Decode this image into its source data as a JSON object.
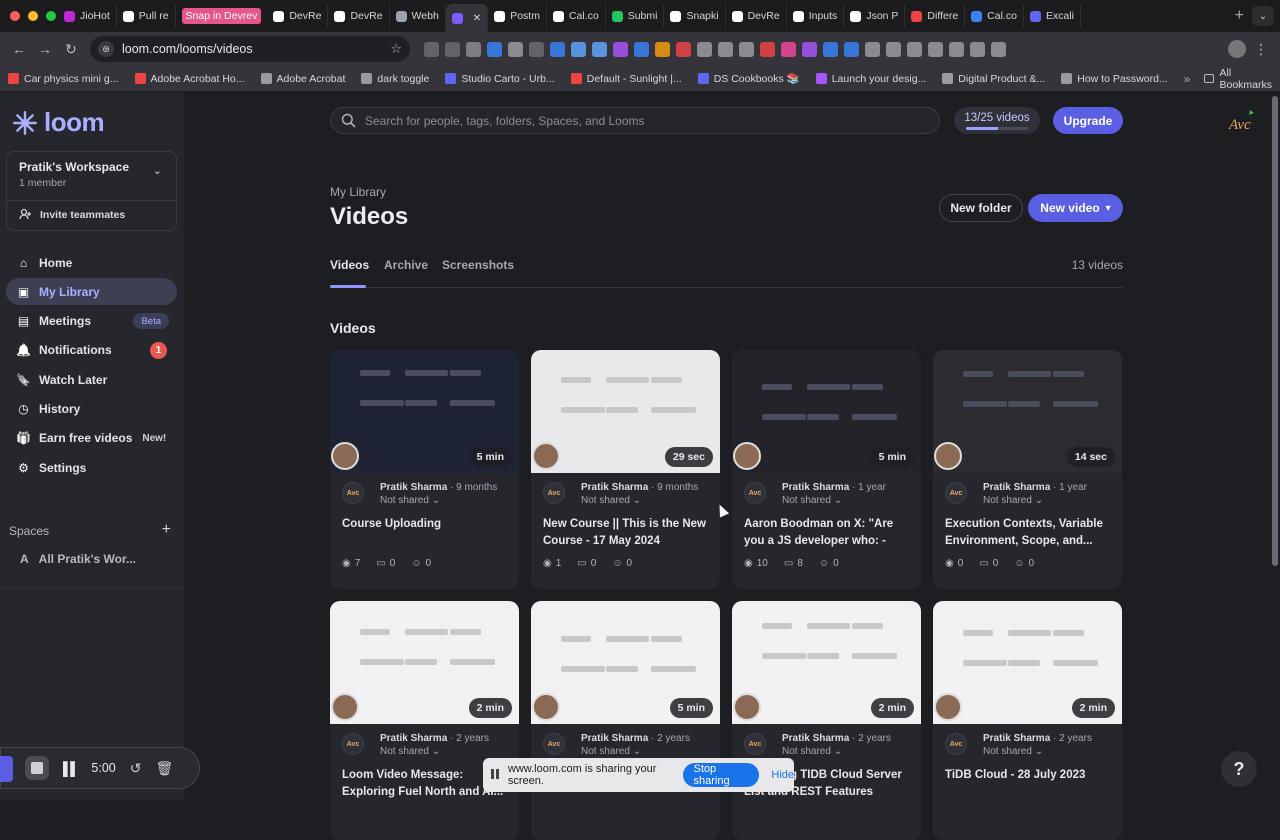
{
  "browser": {
    "tabs": [
      {
        "label": "JioHot",
        "color": "#c026d3"
      },
      {
        "label": "Pull re",
        "color": "#ffffff"
      },
      {
        "label": "Snap in Devrev",
        "color": "#e7568b",
        "snap": true
      },
      {
        "label": "DevRe",
        "color": "#ffffff"
      },
      {
        "label": "DevRe",
        "color": "#ffffff"
      },
      {
        "label": "Webh",
        "color": "#9ca3af"
      },
      {
        "label": "",
        "color": "#7c5cff",
        "active": true
      },
      {
        "label": "Postm",
        "color": "#ffffff"
      },
      {
        "label": "Cal.co",
        "color": "#ffffff"
      },
      {
        "label": "Submi",
        "color": "#22c55e"
      },
      {
        "label": "Snapki",
        "color": "#ffffff"
      },
      {
        "label": "DevRe",
        "color": "#ffffff"
      },
      {
        "label": "Inputs",
        "color": "#ffffff"
      },
      {
        "label": "Json P",
        "color": "#ffffff"
      },
      {
        "label": "Differe",
        "color": "#ef4444"
      },
      {
        "label": "Cal.co",
        "color": "#3b82f6"
      },
      {
        "label": "Excali",
        "color": "#6366f1"
      }
    ],
    "url": "loom.com/looms/videos",
    "extension_colors": [
      "#6b6b70",
      "#6b6b70",
      "#8b8b90",
      "#3b82f6",
      "#9a9aa0",
      "#6b6b70",
      "#3b82f6",
      "#60a5fa",
      "#60a5fa",
      "#a855f7",
      "#3b82f6",
      "#f59e0b",
      "#ef4444",
      "#9a9aa0",
      "#9a9aa0",
      "#9a9aa0",
      "#ef4444",
      "#ec4899",
      "#a855f7",
      "#3b82f6",
      "#3b82f6",
      "#9a9aa0",
      "#9a9aa0",
      "#9a9aa0",
      "#9a9aa0",
      "#9a9aa0",
      "#9a9aa0",
      "#9a9aa0"
    ],
    "bookmarks": [
      {
        "label": "Car physics mini g...",
        "color": "#ef4444"
      },
      {
        "label": "Adobe Acrobat Ho...",
        "color": "#ef4444"
      },
      {
        "label": "Adobe Acrobat",
        "color": "#9a9aa0"
      },
      {
        "label": "dark toggle",
        "color": "#9a9aa0"
      },
      {
        "label": "Studio Carto - Urb...",
        "color": "#6366f1"
      },
      {
        "label": "Default - Sunlight |...",
        "color": "#ef4444"
      },
      {
        "label": "DS Cookbooks 📚",
        "color": "#6366f1"
      },
      {
        "label": "Launch your desig...",
        "color": "#a855f7"
      },
      {
        "label": "Digital Product &...",
        "color": "#9a9aa0"
      },
      {
        "label": "How to Password...",
        "color": "#9a9aa0"
      }
    ],
    "all_bookmarks": "All Bookmarks"
  },
  "sidebar": {
    "logo": "loom",
    "workspace_name": "Pratik's Workspace",
    "workspace_members": "1 member",
    "invite_label": "Invite teammates",
    "nav": [
      {
        "key": "home",
        "label": "Home",
        "icon": "home-icon"
      },
      {
        "key": "library",
        "label": "My Library",
        "icon": "library-icon",
        "active": true
      },
      {
        "key": "meetings",
        "label": "Meetings",
        "icon": "meetings-icon",
        "badge": "Beta"
      },
      {
        "key": "notifications",
        "label": "Notifications",
        "icon": "bell-icon",
        "count": "1"
      },
      {
        "key": "watch-later",
        "label": "Watch Later",
        "icon": "bookmark-icon"
      },
      {
        "key": "history",
        "label": "History",
        "icon": "history-icon"
      },
      {
        "key": "earn",
        "label": "Earn free videos",
        "icon": "gift-icon",
        "tag": "New!"
      },
      {
        "key": "settings",
        "label": "Settings",
        "icon": "gear-icon"
      }
    ],
    "spaces_label": "Spaces",
    "space_item": {
      "initial": "A",
      "label": "All Pratik's Wor..."
    }
  },
  "header": {
    "search_placeholder": "Search for people, tags, folders, Spaces, and Looms",
    "video_quota": "13/25 videos",
    "video_quota_fraction": 0.52,
    "upgrade_label": "Upgrade"
  },
  "main": {
    "breadcrumb": "My Library",
    "title": "Videos",
    "new_folder_label": "New folder",
    "new_video_label": "New video",
    "tabs": [
      {
        "label": "Videos",
        "active": true
      },
      {
        "label": "Archive"
      },
      {
        "label": "Screenshots"
      }
    ],
    "video_count": "13 videos",
    "section_title": "Videos",
    "videos": [
      {
        "author": "Pratik Sharma",
        "age": "9 months",
        "share": "Not shared",
        "title": "Course Uploading",
        "duration": "5 min",
        "views": "7",
        "comments": "0",
        "reactions": "0",
        "theme": "#1e2336"
      },
      {
        "author": "Pratik Sharma",
        "age": "9 months",
        "share": "Not shared",
        "title": "New Course || This is the New Course - 17 May 2024",
        "duration": "29 sec",
        "views": "1",
        "comments": "0",
        "reactions": "0",
        "theme": "#e9e9ec"
      },
      {
        "author": "Pratik Sharma",
        "age": "1 year",
        "share": "Not shared",
        "title": "Aaron Boodman on X: \"Are you a JS developer who: - has...",
        "duration": "5 min",
        "views": "10",
        "comments": "8",
        "reactions": "0",
        "theme": "#23232a"
      },
      {
        "author": "Pratik Sharma",
        "age": "1 year",
        "share": "Not shared",
        "title": "Execution Contexts, Variable Environment, Scope, and...",
        "duration": "14 sec",
        "views": "0",
        "comments": "0",
        "reactions": "0",
        "theme": "#2b2b30"
      },
      {
        "author": "Pratik Sharma",
        "age": "2 years",
        "share": "Not shared",
        "title": "Loom Video Message: Exploring Fuel North and AI...",
        "duration": "2 min",
        "views": "",
        "comments": "",
        "reactions": "",
        "theme": "#f1f1f3"
      },
      {
        "author": "Pratik Sharma",
        "age": "2 years",
        "share": "Not shared",
        "title": "Server 👋",
        "duration": "5 min",
        "views": "",
        "comments": "",
        "reactions": "",
        "theme": "#f1f1f3"
      },
      {
        "author": "Pratik Sharma",
        "age": "2 years",
        "share": "Not shared",
        "title": "Exploring TIDB Cloud Server List and REST Features",
        "duration": "2 min",
        "views": "",
        "comments": "",
        "reactions": "",
        "theme": "#f1f1f3"
      },
      {
        "author": "Pratik Sharma",
        "age": "2 years",
        "share": "Not shared",
        "title": "TiDB Cloud - 28 July 2023",
        "duration": "2 min",
        "views": "",
        "comments": "",
        "reactions": "",
        "theme": "#f1f1f3"
      }
    ]
  },
  "recorder": {
    "time": "5:00"
  },
  "share_bar": {
    "text": "www.loom.com is sharing your screen.",
    "stop_label": "Stop sharing",
    "hide_label": "Hide"
  },
  "help_label": "?",
  "avatar_initials": "Avc"
}
